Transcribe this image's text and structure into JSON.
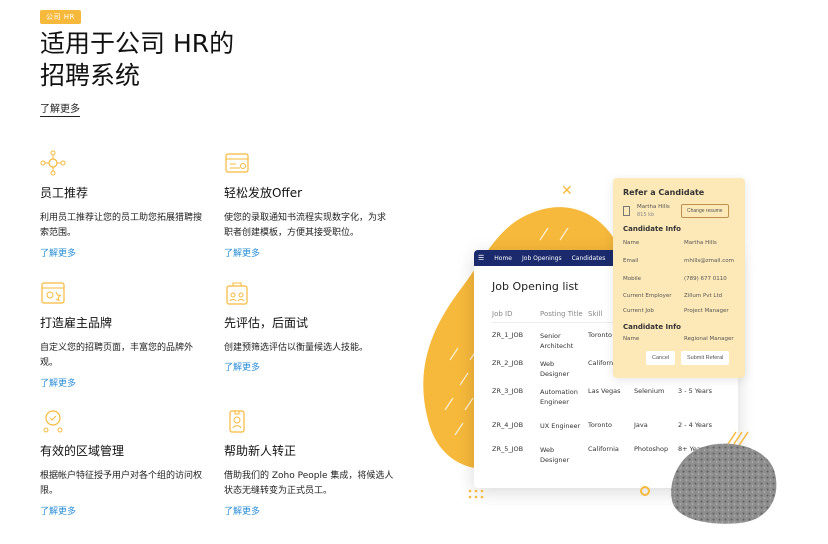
{
  "hero": {
    "tag": "公司 HR",
    "title_line1": "适用于公司 HR的",
    "title_line2": "招聘系统",
    "link": "了解更多"
  },
  "features": [
    {
      "icon": "referral-network-icon",
      "title": "员工推荐",
      "desc": "利用员工推荐让您的员工助您拓展猎聘搜索范围。",
      "link": "了解更多"
    },
    {
      "icon": "offer-letter-icon",
      "title": "轻松发放Offer",
      "desc": "使您的录取通知书流程实现数字化，为求职者创建模板，方便其接受职位。",
      "link": "了解更多"
    },
    {
      "icon": "employer-brand-icon",
      "title": "打造雇主品牌",
      "desc": "自定义您的招聘页面，丰富您的品牌外观。",
      "link": "了解更多"
    },
    {
      "icon": "assessment-icon",
      "title": "先评估，后面试",
      "desc": "创建预筛选评估以衡量候选人技能。",
      "link": "了解更多"
    },
    {
      "icon": "territory-management-icon",
      "title": "有效的区域管理",
      "desc": "根据帐户特征授予用户对各个组的访问权限。",
      "link": "了解更多"
    },
    {
      "icon": "employee-badge-icon",
      "title": "帮助新人转正",
      "desc": "借助我们的 Zoho People 集成，将候选人状态无缝转变为正式员工。",
      "link": "了解更多"
    }
  ],
  "app": {
    "nav": [
      "Home",
      "Job Openings",
      "Candidates"
    ],
    "list_title": "Job Opening list",
    "columns": [
      "Job ID",
      "Posting Title",
      "Skill"
    ],
    "rows": [
      {
        "id": "ZR_1_JOB",
        "title_a": "Senior",
        "title_b": "Architecht",
        "loc": "Toronto",
        "skill": "",
        "exp": ""
      },
      {
        "id": "ZR_2_JOB",
        "title_a": "Web",
        "title_b": "Designer",
        "loc": "California",
        "skill": "",
        "exp": ""
      },
      {
        "id": "ZR_3_JOB",
        "title_a": "Automation",
        "title_b": "Engineer",
        "loc": "Las Vegas",
        "skill": "Selenium",
        "exp": "3 - 5 Years"
      },
      {
        "id": "ZR_4_JOB",
        "title_a": "UX Engineer",
        "title_b": "",
        "loc": "Toronto",
        "skill": "Java",
        "exp": "2 - 4 Years"
      },
      {
        "id": "ZR_5_JOB",
        "title_a": "Web",
        "title_b": "Designer",
        "loc": "California",
        "skill": "Photoshop",
        "exp": "8+ Years"
      }
    ]
  },
  "refer": {
    "title": "Refer a Candidate",
    "file_name": "Martha Hills",
    "file_size": "815 kb",
    "change_resume": "Change resume",
    "candidate_info_1": "Candidate Info",
    "fields": [
      {
        "key": "Name",
        "value": "Martha Hills"
      },
      {
        "key": "Email",
        "value": "mhills@zmail.com"
      },
      {
        "key": "Mobile",
        "value": "(789) 677 0110"
      },
      {
        "key": "Current Employer",
        "value": "Zillum Pvt Ltd"
      },
      {
        "key": "Current Job",
        "value": "Project Manager"
      }
    ],
    "candidate_info_2": "Candidate Info",
    "fields2": [
      {
        "key": "Name",
        "value": "Regional Manager"
      }
    ],
    "cancel": "Cancel",
    "submit": "Submit Referal"
  },
  "colors": {
    "accent": "#f6b93b",
    "link": "#2b8fd6",
    "nav": "#1a2a6c",
    "refer_bg": "#fde9b8"
  }
}
